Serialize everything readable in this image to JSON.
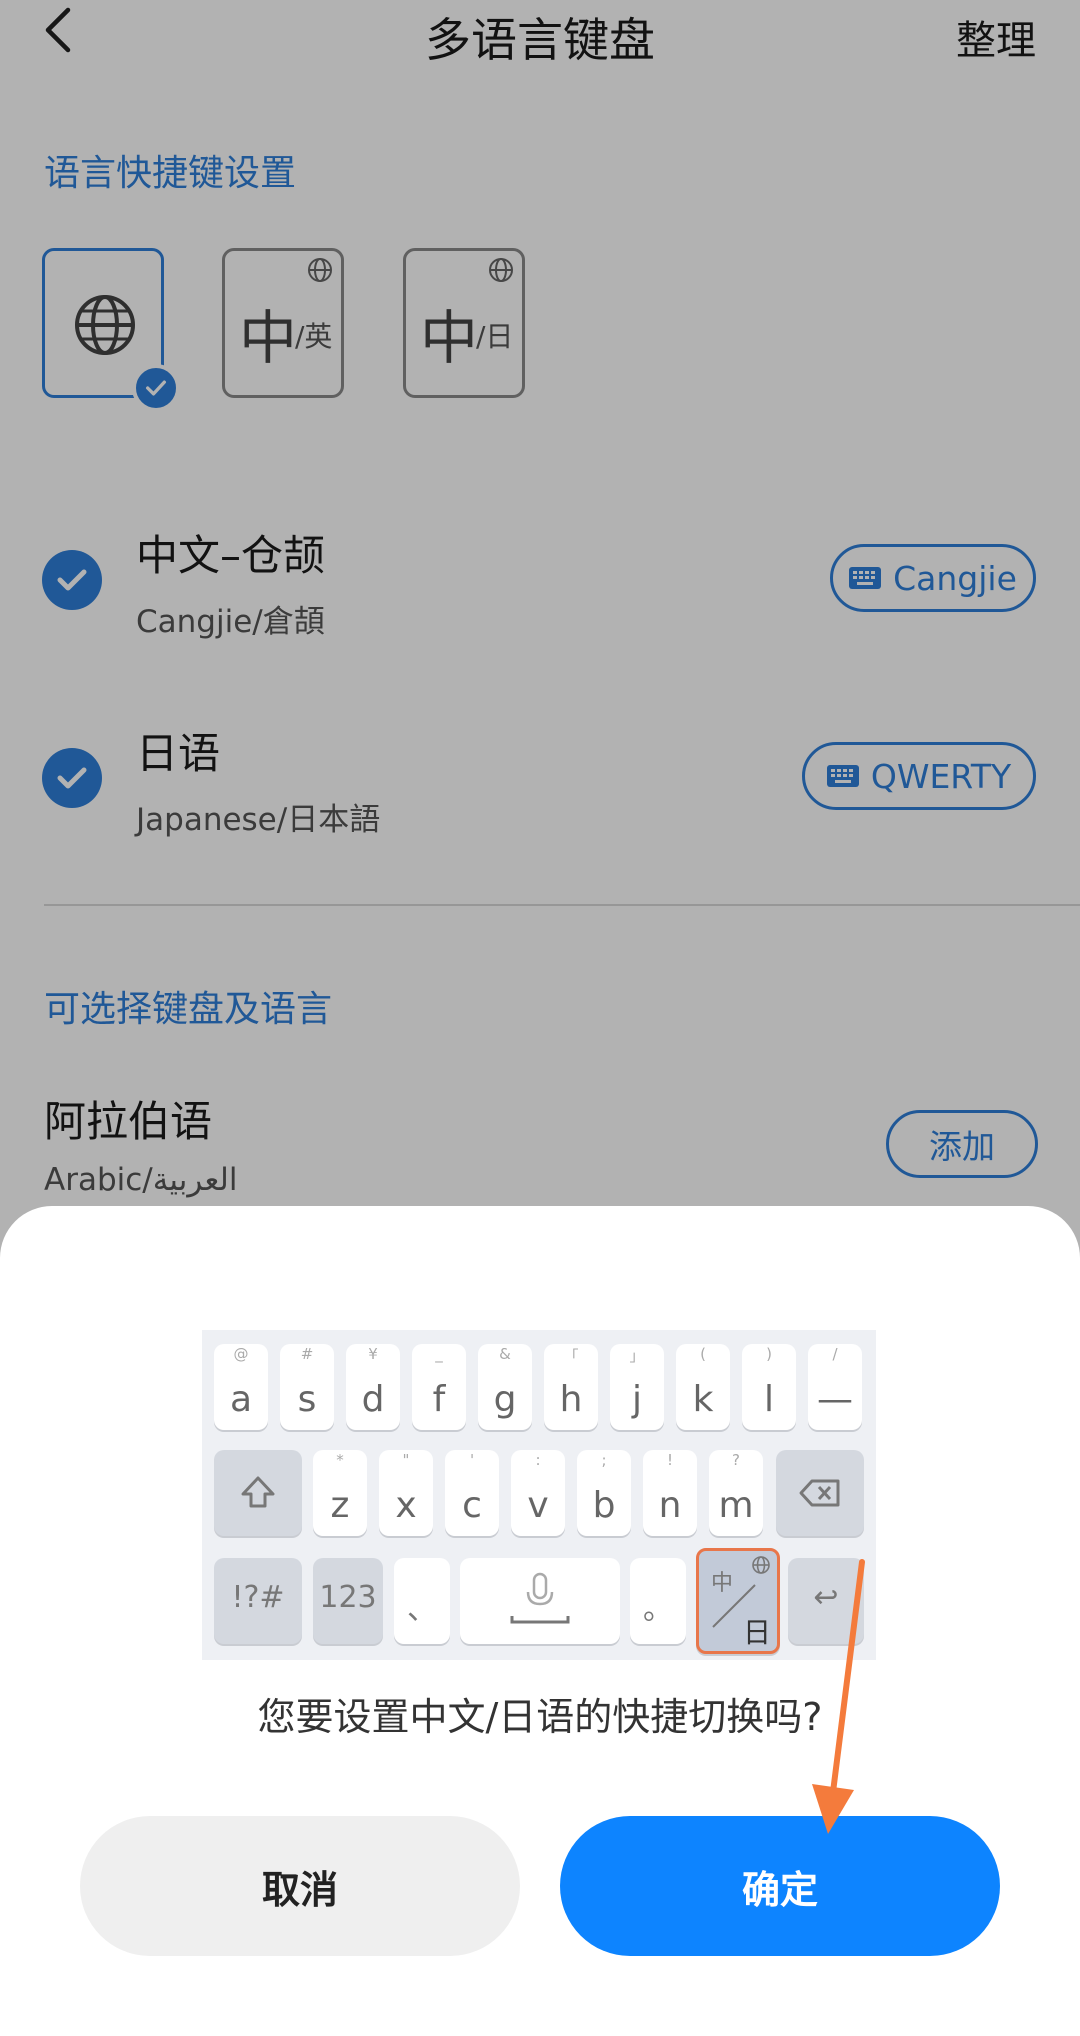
{
  "header": {
    "title": "多语言键盘",
    "organize": "整理"
  },
  "shortcut_section": {
    "title": "语言快捷键设置",
    "options": [
      {
        "icon": "globe-icon",
        "selected": true
      },
      {
        "big": "中",
        "small": "/英",
        "selected": false
      },
      {
        "big": "中",
        "small": "/日",
        "selected": false
      }
    ]
  },
  "enabled_languages": [
    {
      "name": "中文–仓颉",
      "sub": "Cangjie/倉頡",
      "layout": "Cangjie"
    },
    {
      "name": "日语",
      "sub": "Japanese/日本語",
      "layout": "QWERTY"
    }
  ],
  "available_section": {
    "title": "可选择键盘及语言",
    "items": [
      {
        "name": "阿拉伯语",
        "sub": "Arabic/العربية",
        "action": "添加"
      }
    ]
  },
  "dialog": {
    "keyboard": {
      "row1": [
        {
          "main": "a",
          "sup": "@"
        },
        {
          "main": "s",
          "sup": "#"
        },
        {
          "main": "d",
          "sup": "¥"
        },
        {
          "main": "f",
          "sup": "_"
        },
        {
          "main": "g",
          "sup": "&"
        },
        {
          "main": "h",
          "sup": "「"
        },
        {
          "main": "j",
          "sup": "」"
        },
        {
          "main": "k",
          "sup": "("
        },
        {
          "main": "l",
          "sup": ")"
        },
        {
          "main": "—",
          "sup": "/"
        }
      ],
      "row2": [
        {
          "main": "z",
          "sup": "*"
        },
        {
          "main": "x",
          "sup": "\""
        },
        {
          "main": "c",
          "sup": "'"
        },
        {
          "main": "v",
          "sup": ":"
        },
        {
          "main": "b",
          "sup": ";"
        },
        {
          "main": "n",
          "sup": "!"
        },
        {
          "main": "m",
          "sup": "?"
        }
      ],
      "symbols": "!?#",
      "numbers": "123",
      "comma": "、",
      "period": "。",
      "lang_key_top": "中",
      "lang_key_bottom": "日",
      "enter": "↩"
    },
    "question": "您要设置中文/日语的快捷切换吗?",
    "cancel": "取消",
    "confirm": "确定"
  },
  "colors": {
    "accent": "#2f7fd8",
    "confirm": "#0d84ff",
    "annotation_arrow": "#f47b3c"
  }
}
